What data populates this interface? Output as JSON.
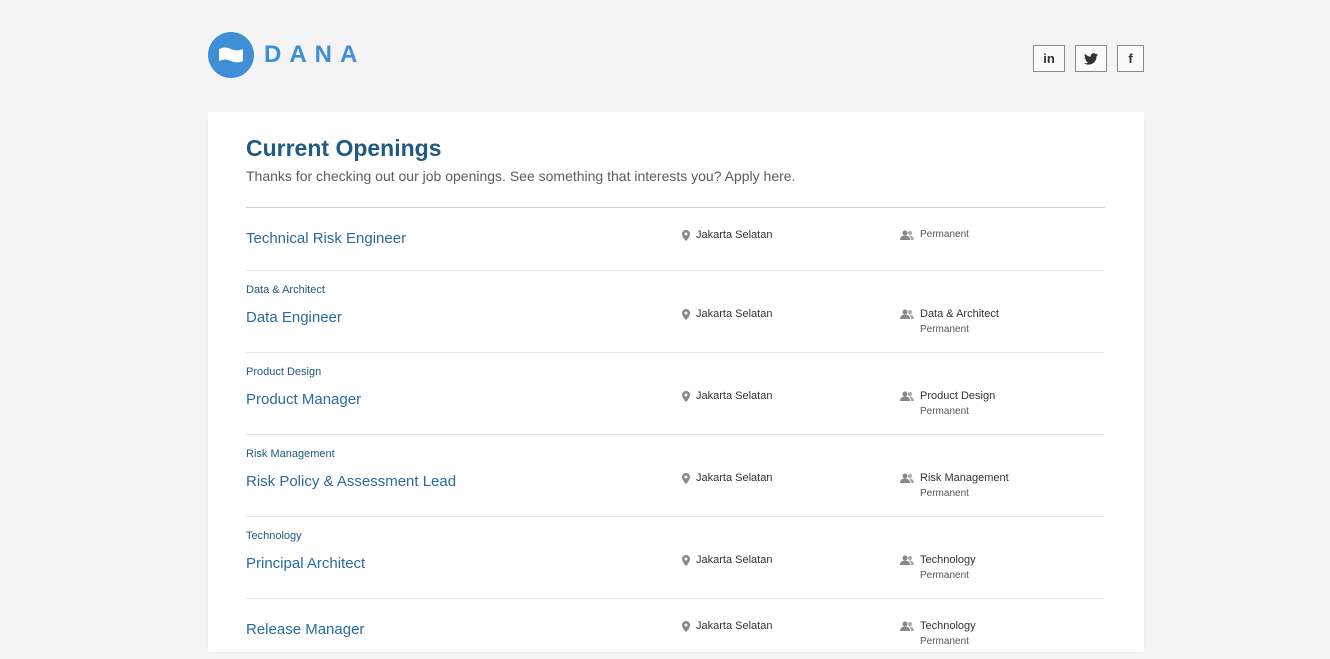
{
  "brand": {
    "name": "DANA",
    "color": "#3f8fd6"
  },
  "social": {
    "linkedin": "in",
    "twitter": "twitter-icon",
    "facebook": "f"
  },
  "page": {
    "title": "Current Openings",
    "subtitle": "Thanks for checking out our job openings. See something that interests you? Apply here."
  },
  "jobs": [
    {
      "dept": "",
      "title": "Technical Risk Engineer",
      "location": "Jakarta Selatan",
      "team": "Permanent",
      "type": ""
    },
    {
      "dept": "Data & Architect",
      "title": "Data Engineer",
      "location": "Jakarta Selatan",
      "team": "Data & Architect",
      "type": "Permanent"
    },
    {
      "dept": "Product Design",
      "title": "Product Manager",
      "location": "Jakarta Selatan",
      "team": "Product Design",
      "type": "Permanent"
    },
    {
      "dept": "Risk Management",
      "title": "Risk Policy & Assessment Lead",
      "location": "Jakarta Selatan",
      "team": "Risk Management",
      "type": "Permanent"
    },
    {
      "dept": "Technology",
      "title": "Principal Architect",
      "location": "Jakarta Selatan",
      "team": "Technology",
      "type": "Permanent"
    },
    {
      "dept": "",
      "title": "Release Manager",
      "location": "Jakarta Selatan",
      "team": "Technology",
      "type": "Permanent"
    }
  ],
  "colors": {
    "title": "#1e5a82",
    "link": "#2a6a9c",
    "background": "#f4f4f4"
  }
}
